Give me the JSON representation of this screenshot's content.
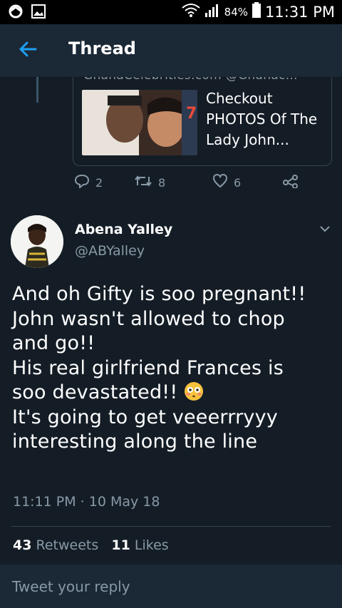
{
  "status_bar": {
    "battery_percent": "84%",
    "time": "11:31 PM"
  },
  "app_bar": {
    "title": "Thread"
  },
  "link_card": {
    "source": "GhanaCelebrities.com @Ghanac...",
    "title": "Checkout PHOTOS Of The Lady John..."
  },
  "actions": {
    "replies": "2",
    "retweets": "8",
    "likes": "6"
  },
  "tweet": {
    "author_name": "Abena Yalley",
    "author_handle": "@ABYalley",
    "lines": [
      "And oh Gifty is soo pregnant!!",
      "John wasn't allowed to chop",
      "and go!!",
      "His real girlfriend Frances is",
      "soo devastated!!",
      "It's going to get veeerrryyy",
      "interesting along the line"
    ],
    "emoji": "flushed-face-emoji",
    "timestamp": "11:11 PM · 10 May 18",
    "retweet_count": "43",
    "retweet_label": "Retweets",
    "like_count": "11",
    "like_label": "Likes"
  },
  "reply": {
    "placeholder": "Tweet your reply"
  },
  "colors": {
    "background": "#141d26",
    "bar": "#1b2836",
    "accent": "#1da1f2",
    "muted": "#8899a6"
  }
}
